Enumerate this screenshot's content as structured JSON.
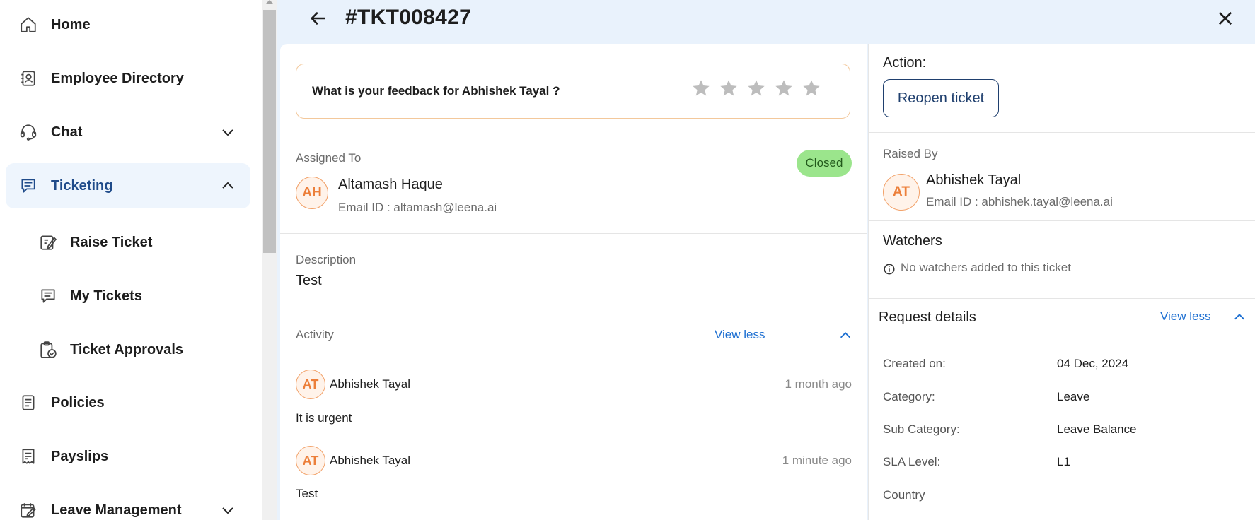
{
  "sidebar": {
    "items": [
      {
        "label": "Home",
        "icon": "home-icon"
      },
      {
        "label": "Employee Directory",
        "icon": "contact-book-icon"
      },
      {
        "label": "Chat",
        "icon": "headset-icon"
      },
      {
        "label": "Ticketing",
        "icon": "ticket-chat-icon"
      },
      {
        "label": "Raise Ticket",
        "icon": "edit-note-icon"
      },
      {
        "label": "My Tickets",
        "icon": "ticket-chat-icon"
      },
      {
        "label": "Ticket Approvals",
        "icon": "clipboard-check-icon"
      },
      {
        "label": "Policies",
        "icon": "document-icon"
      },
      {
        "label": "Payslips",
        "icon": "receipt-icon"
      },
      {
        "label": "Leave Management",
        "icon": "calendar-edit-icon"
      }
    ]
  },
  "header": {
    "ticket_id": "#TKT008427"
  },
  "feedback": {
    "question": "What is your feedback for Abhishek Tayal ?",
    "rating": 0,
    "max_rating": 5
  },
  "assignment": {
    "label": "Assigned To",
    "initials": "AH",
    "name": "Altamash Haque",
    "email": "Email ID : altamash@leena.ai",
    "status": "Closed"
  },
  "description": {
    "label": "Description",
    "value": "Test"
  },
  "activity": {
    "label": "Activity",
    "toggle": "View less",
    "entries": [
      {
        "initials": "AT",
        "name": "Abhishek Tayal",
        "time": "1 month ago",
        "text": "It is urgent"
      },
      {
        "initials": "AT",
        "name": "Abhishek Tayal",
        "time": "1 minute ago",
        "text": "Test"
      }
    ]
  },
  "action": {
    "label": "Action:",
    "reopen": "Reopen ticket"
  },
  "raised_by": {
    "label": "Raised By",
    "initials": "AT",
    "name": "Abhishek Tayal",
    "email": "Email ID : abhishek.tayal@leena.ai"
  },
  "watchers": {
    "title": "Watchers",
    "empty": "No watchers added to this ticket"
  },
  "request_details": {
    "title": "Request details",
    "toggle": "View less",
    "rows": [
      {
        "key": "Created on:",
        "value": "04 Dec, 2024"
      },
      {
        "key": "Category:",
        "value": "Leave"
      },
      {
        "key": "Sub Category:",
        "value": "Leave Balance"
      },
      {
        "key": "SLA Level:",
        "value": "L1"
      },
      {
        "key": "Country",
        "value": ""
      }
    ]
  },
  "colors": {
    "accent": "#1d6fd1",
    "active_nav_bg": "#eef5fd",
    "status_closed": "#9be58c",
    "avatar_orange": "#ec7f3a"
  }
}
